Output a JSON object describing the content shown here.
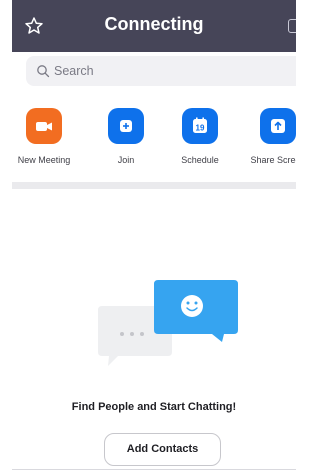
{
  "header": {
    "title": "Connecting"
  },
  "search": {
    "placeholder": "Search"
  },
  "actions": [
    {
      "label": "New Meeting",
      "icon": "video-camera-icon",
      "color": "#F26D21"
    },
    {
      "label": "Join",
      "icon": "plus-icon",
      "color": "#0E71EB"
    },
    {
      "label": "Schedule",
      "icon": "calendar-icon",
      "color": "#0E71EB",
      "day": "19"
    },
    {
      "label": "Share Screen",
      "icon": "share-screen-icon",
      "color": "#0E71EB"
    }
  ],
  "empty_state": {
    "title": "Find People and Start Chatting!",
    "button": "Add Contacts",
    "icons": [
      "chat-bubble-grey-icon",
      "chat-bubble-blue-smiley-icon"
    ]
  },
  "colors": {
    "topbar": "#464558",
    "accent": "#0E71EB",
    "orange": "#F26D21",
    "bubble_blue": "#36A4F0"
  }
}
